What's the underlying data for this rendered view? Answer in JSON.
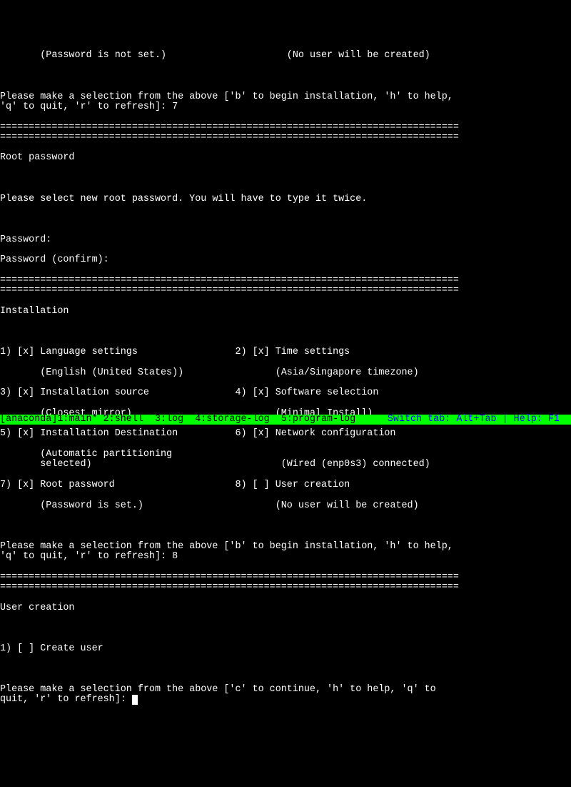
{
  "top_status": {
    "password_status": "(Password is not set.)",
    "user_status": "(No user will be created)"
  },
  "prompt1": "Please make a selection from the above ['b' to begin installation, 'h' to help,\n'q' to quit, 'r' to refresh]: 7",
  "separator": "================================================================================\n================================================================================",
  "root_password_section": {
    "title": "Root password",
    "instruction": "Please select new root password. You will have to type it twice.",
    "password_label": "Password: ",
    "password_confirm_label": "Password (confirm): "
  },
  "installation_section": {
    "title": "Installation",
    "items": [
      {
        "num": "1",
        "checked": true,
        "label": "Language settings",
        "detail": "(English (United States))"
      },
      {
        "num": "2",
        "checked": true,
        "label": "Time settings",
        "detail": "(Asia/Singapore timezone)"
      },
      {
        "num": "3",
        "checked": true,
        "label": "Installation source",
        "detail": "(Closest mirror)"
      },
      {
        "num": "4",
        "checked": true,
        "label": "Software selection",
        "detail": "(Minimal Install)"
      },
      {
        "num": "5",
        "checked": true,
        "label": "Installation Destination",
        "detail": "(Automatic partitioning\n       selected)"
      },
      {
        "num": "6",
        "checked": true,
        "label": "Network configuration",
        "detail": "(Wired (enp0s3) connected)"
      },
      {
        "num": "7",
        "checked": true,
        "label": "Root password",
        "detail": "(Password is set.)"
      },
      {
        "num": "8",
        "checked": false,
        "label": "User creation",
        "detail": "(No user will be created)"
      }
    ]
  },
  "prompt2": "Please make a selection from the above ['b' to begin installation, 'h' to help,\n'q' to quit, 'r' to refresh]: 8",
  "user_creation_section": {
    "title": "User creation",
    "option": "1) [ ] Create user"
  },
  "prompt3": "Please make a selection from the above ['c' to continue, 'h' to help, 'q' to\nquit, 'r' to refresh]: ",
  "status_bar": {
    "left": "[anaconda]1:main* 2:shell  3:log  4:storage-log  5:program-log",
    "right": "Switch tab: Alt+Tab | Help: F1 "
  }
}
